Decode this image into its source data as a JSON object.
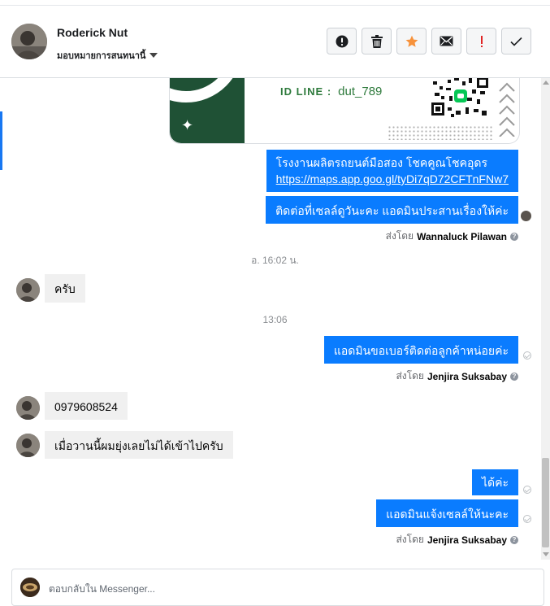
{
  "header": {
    "contact_name": "Roderick Nut",
    "assign_label": "มอบหมายการสนทนานี้",
    "actions": [
      {
        "name": "spam-report",
        "icon": "exclamation-circle-icon"
      },
      {
        "name": "delete",
        "icon": "trash-icon"
      },
      {
        "name": "star",
        "icon": "star-icon"
      },
      {
        "name": "mark-unread",
        "icon": "envelope-icon"
      },
      {
        "name": "follow-up",
        "icon": "red-exclamation-icon"
      },
      {
        "name": "mark-done",
        "icon": "checkmark-icon"
      }
    ]
  },
  "image_card": {
    "id_label": "ID LINE :",
    "id_value": "dut_789"
  },
  "messages": {
    "m1_line1": "โรงงานผลิตรถยนต์มือสอง โชคคูณโชคอุดร",
    "m1_link": "https://maps.app.goo.gl/tyDi7qD72CFTnFNw7",
    "m2": "ติดต่อที่เซลล์ดูวันะคะ แอดมินประสานเรื่องให้ค่ะ",
    "sent_by_1_prefix": "ส่งโดย",
    "sent_by_1_name": "Wannaluck Pilawan",
    "time_1": "อ. 16:02 น.",
    "m3": "ครับ",
    "time_2": "13:06",
    "m4": "แอดมินขอเบอร์ติดต่อลูกค้าหน่อยค่ะ",
    "sent_by_2_prefix": "ส่งโดย",
    "sent_by_2_name": "Jenjira Suksabay",
    "m5": "0979608524",
    "m6": "เมื่อวานนี้ผมยุ่งเลยไม่ได้เข้าไปครับ",
    "m7": "ได้ค่ะ",
    "m8": "แอดมินแจ้งเซลล์ให้นะคะ",
    "sent_by_3_prefix": "ส่งโดย",
    "sent_by_3_name": "Jenjira Suksabay"
  },
  "reply": {
    "placeholder": "ตอบกลับใน Messenger..."
  },
  "colors": {
    "outgoing_bubble": "#0a7cff",
    "incoming_bubble": "#f0f0f0",
    "accent_bar": "#1877f2",
    "star_orange": "#f7923b",
    "flag_red": "#e02424"
  }
}
